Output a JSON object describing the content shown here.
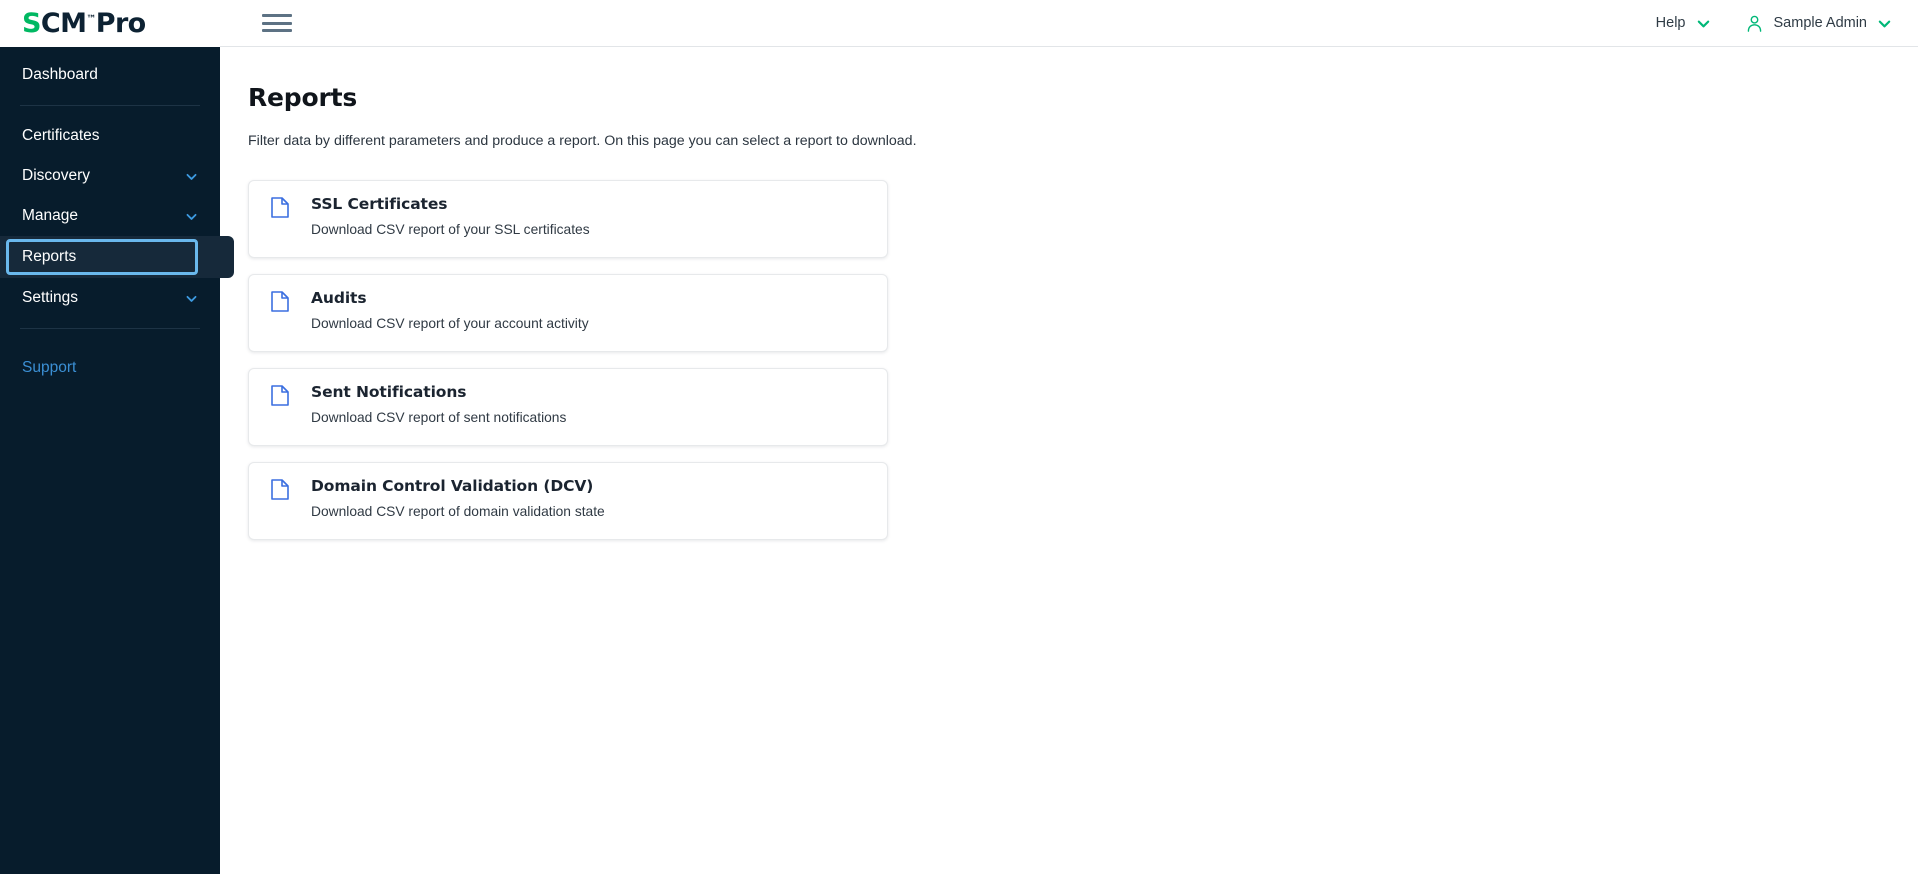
{
  "brand": {
    "logo_s": "S",
    "logo_cm": "CM",
    "logo_tm": "™",
    "logo_pro": "Pro",
    "accent_green": "#00b862",
    "navy": "#071c2c",
    "link_blue": "#3b8fd4",
    "focus_blue": "#6ab8ec",
    "icon_blue": "#3b6fe0"
  },
  "sidebar": {
    "top_items": [
      {
        "label": "Dashboard",
        "has_chevron": false,
        "focused": false
      }
    ],
    "items": [
      {
        "label": "Certificates",
        "has_chevron": false,
        "focused": false
      },
      {
        "label": "Discovery",
        "has_chevron": true,
        "focused": false
      },
      {
        "label": "Manage",
        "has_chevron": true,
        "focused": false
      },
      {
        "label": "Reports",
        "has_chevron": false,
        "focused": true
      },
      {
        "label": "Settings",
        "has_chevron": true,
        "focused": false
      }
    ],
    "support_label": "Support"
  },
  "header": {
    "menu_icon": "hamburger-icon",
    "help_label": "Help",
    "user_label": "Sample Admin",
    "user_icon": "person-icon",
    "chevron_icon": "chevron-down-icon"
  },
  "main": {
    "title": "Reports",
    "description": "Filter data by different parameters and produce a report. On this page you can select a report to download.",
    "cards": [
      {
        "icon": "document-icon",
        "title": "SSL Certificates",
        "subtitle": "Download CSV report of your SSL certificates"
      },
      {
        "icon": "document-icon",
        "title": "Audits",
        "subtitle": "Download CSV report of your account activity"
      },
      {
        "icon": "document-icon",
        "title": "Sent Notifications",
        "subtitle": "Download CSV report of sent notifications"
      },
      {
        "icon": "document-icon",
        "title": "Domain Control Validation (DCV)",
        "subtitle": "Download CSV report of domain validation state"
      }
    ]
  }
}
